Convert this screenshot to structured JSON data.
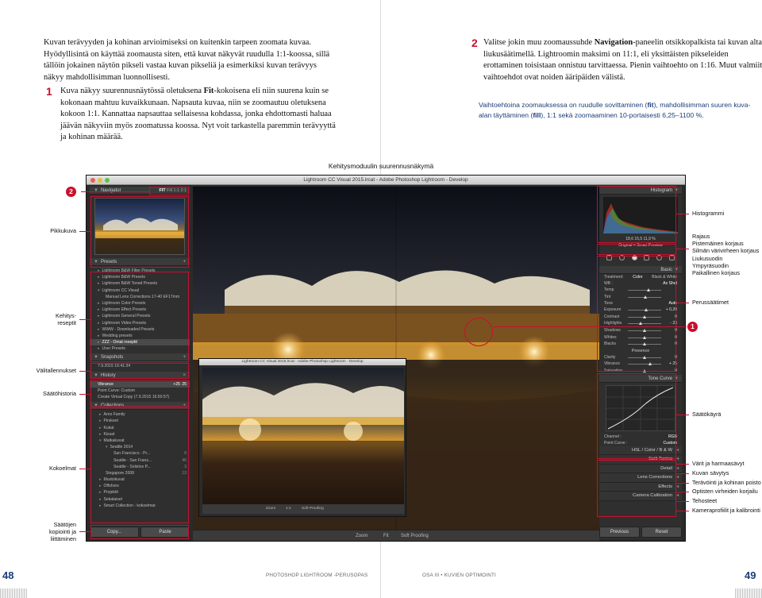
{
  "left_page": {
    "intro": "Kuvan terävyyden ja kohinan arvioimiseksi on kuitenkin tarpeen zoomata kuvaa. Hyödyllisintä on käyttää zoomausta siten, että kuvat näkyvät ruudulla 1:1-koossa, sillä tällöin jokainen näytön pikseli vastaa kuvan pikseliä ja esimerkiksi kuvan terävyys näkyy mahdollisimman luonnollisesti.",
    "step1_number": "1",
    "step1_pre": "Kuva näkyy suurennusnäytössä oletuksena ",
    "step1_bold": "Fit",
    "step1_post": "-kokoisena eli niin suurena kuin se kokonaan mahtuu kuvaikkunaan. Napsauta kuvaa, niin se zoomautuu oletuksena kokoon 1:1. Kannattaa napsauttaa sellaisessa kohdassa, jonka ehdottomasti haluaa jäävän näkyviin myös zoomatussa koossa. Nyt voit tarkastella paremmin terävyyttä ja kohinan määrää."
  },
  "right_page": {
    "step2_number": "2",
    "step2_pre": "Valitse jokin muu zoomaussuhde ",
    "step2_bold": "Navigation",
    "step2_post": "-paneelin otsikkopalkista tai kuvan alta liukusäätimellä. Lightroomin maksimi on 11:1, eli yksittäisten pikseleiden erottaminen toisistaan onnistuu tarvittaessa. Pienin vaihtoehto on 1:16. Muut valmiit vaihtoehdot ovat noiden ääripäiden välistä.",
    "caption_pre": "Vaihtoehtoina zoomauksessa on ruudulle sovittaminen (",
    "caption_fit": "fit",
    "caption_mid": "), mahdollisimman suuren kuva-alan täyttäminen (",
    "caption_fill": "fill",
    "caption_post": "), 1:1 sekä zoomaaminen 10-portaisesti 6,25–1100 %."
  },
  "screenshot": {
    "title": "Kehitysmoduulin suurennusnäkymä",
    "window_title": "Lightroom CC Visual 2015.lrcat - Adobe Photoshop Lightroom - Develop",
    "badge_1": "1",
    "badge_2": "2",
    "navigator": {
      "label": "Navigator",
      "zoom_fit": "FIT",
      "zoom_fill": "Fill",
      "zoom_1": "1:1",
      "zoom_2": "2:1"
    },
    "presets": {
      "label": "Presets",
      "items": [
        "Lightroom B&W Filter Presets",
        "Lightroom B&W Presets",
        "Lightroom B&W Toned Presets",
        "Lightroom CC Visual",
        "Manual Lens Corrections 17-40 EF17mm",
        "Lightroom Color Presets",
        "Lightroom Effect Presets",
        "Lightroom General Presets",
        "Lightroom Video Presets",
        "WWW - Downloaded Presets",
        "Wedding presets",
        "ZZZ - Omat reseptit",
        "User Presets"
      ]
    },
    "snapshots": {
      "label": "Snapshots",
      "item": "7.9.2015 16:41:34"
    },
    "history": {
      "label": "History",
      "items": [
        {
          "name": "Vibrance",
          "val1": "+25",
          "val2": "25"
        },
        {
          "name": "Point Curve: Custom",
          "val1": "",
          "val2": ""
        },
        {
          "name": "Create Virtual Copy (7.9.2015 16:50:57)",
          "val1": "",
          "val2": ""
        }
      ]
    },
    "collections": {
      "label": "Collections",
      "items": [
        {
          "name": "Arno Family",
          "count": ""
        },
        {
          "name": "Pirskeet",
          "count": ""
        },
        {
          "name": "Kukat",
          "count": ""
        },
        {
          "name": "Kissat",
          "count": ""
        },
        {
          "name": "Matkakuvat",
          "count": ""
        },
        {
          "name": "Seattle 2014",
          "count": ""
        },
        {
          "name": "San Francisco - Pr...",
          "count": "8"
        },
        {
          "name": "Seattle - San Frans...",
          "count": "46"
        },
        {
          "name": "Seattle - Solstice P...",
          "count": "3"
        },
        {
          "name": "Singapore 2008",
          "count": "13"
        },
        {
          "name": "Muotokuvat",
          "count": ""
        },
        {
          "name": "Offshore",
          "count": ""
        },
        {
          "name": "Projektit",
          "count": ""
        },
        {
          "name": "Sekalaiset",
          "count": ""
        },
        {
          "name": "Smart Collection - kokoelmat",
          "count": ""
        }
      ]
    },
    "copy_label": "Copy...",
    "paste_label": "Paste",
    "histogram": {
      "label": "Histogram",
      "info": "18,6   15,5   11,9 %",
      "original": "Original + Smart Preview"
    },
    "basic": {
      "label": "Basic",
      "treatment_label": "Treatment:",
      "treatment_color": "Color",
      "treatment_bw": "Black & White",
      "wb_label": "WB :",
      "wb_value": "As Shot",
      "sliders_wb": [
        {
          "name": "Temp",
          "value": ""
        },
        {
          "name": "Tint",
          "value": ""
        }
      ],
      "tone_label": "Tone",
      "tone_auto": "Auto",
      "sliders_tone": [
        {
          "name": "Exposure",
          "value": "+ 0,20"
        },
        {
          "name": "Contrast",
          "value": "0"
        },
        {
          "name": "Highlights",
          "value": "- 23"
        },
        {
          "name": "Shadows",
          "value": "0"
        },
        {
          "name": "Whites",
          "value": "0"
        },
        {
          "name": "Blacks",
          "value": "0"
        }
      ],
      "presence_label": "Presence",
      "sliders_presence": [
        {
          "name": "Clarity",
          "value": "0"
        },
        {
          "name": "Vibrance",
          "value": "+ 25"
        },
        {
          "name": "Saturation",
          "value": "0"
        }
      ]
    },
    "tone_curve": {
      "label": "Tone Curve",
      "channel_label": "Channel :",
      "channel_value": "RGB",
      "point_curve_label": "Point Curve :",
      "point_curve_value": "Custom"
    },
    "hsl": {
      "label": "HSL / Color / B & W"
    },
    "right_panels": [
      "Split Toning",
      "Detail",
      "Lens Corrections",
      "Effects",
      "Camera Calibration"
    ],
    "previous_label": "Previous",
    "reset_label": "Reset",
    "toolbar": {
      "zoom_label": "Zoom",
      "fit_label": "Fit",
      "soft_proofing": "Soft Proofing"
    },
    "inset": {
      "window_title": "Lightroom CC Visual 2015.lrcat - Adobe Photoshop Lightroom - Develop",
      "zoom_label": "Zoom",
      "zoom_value": "1:1",
      "soft_proofing": "Soft Proofing"
    }
  },
  "labels_left": {
    "pikkukuva": "Pikkukuva",
    "kehitysreseptit_1": "Kehitys-",
    "kehitysreseptit_2": "reseptit",
    "valitallennukset": "Välitallennukset",
    "saatohistoria": "Säätöhistoria",
    "kokoelmat": "Kokoelmat",
    "kopiointi_1": "Säätöjen",
    "kopiointi_2": "kopiointi ja",
    "kopiointi_3": "liittäminen"
  },
  "labels_right": {
    "histogrammi": "Histogrammi",
    "tools_1": "Rajaus",
    "tools_2": "Pistemäinen korjaus",
    "tools_3": "Silmän värivirheen korjaus",
    "tools_4": "Liukusuodin",
    "tools_5": "Ympyräsuodin",
    "tools_6": "Paikallinen korjaus",
    "perussaadot": "Perussäätimet",
    "saatokayra": "Säätökäyrä",
    "varit": "Värit ja harmaasävyt",
    "savytys": "Kuvan sävytys",
    "teravyys": "Terävöinti ja kohinan poisto",
    "optiset": "Optisten virheiden korjailu",
    "tehosteet": "Tehosteet",
    "kamera": "Kameraprofiilit ja kalibrointi"
  },
  "footer": {
    "page_left": "48",
    "running_left": "PHOTOSHOP LIGHTROOM -PERUSOPAS",
    "running_right": "OSA III • KUVIEN OPTIMOINTI",
    "page_right": "49"
  },
  "colors": {
    "accent_red": "#c8102e",
    "accent_blue": "#1b3d7a",
    "lr_panel": "#2f2f2f"
  }
}
